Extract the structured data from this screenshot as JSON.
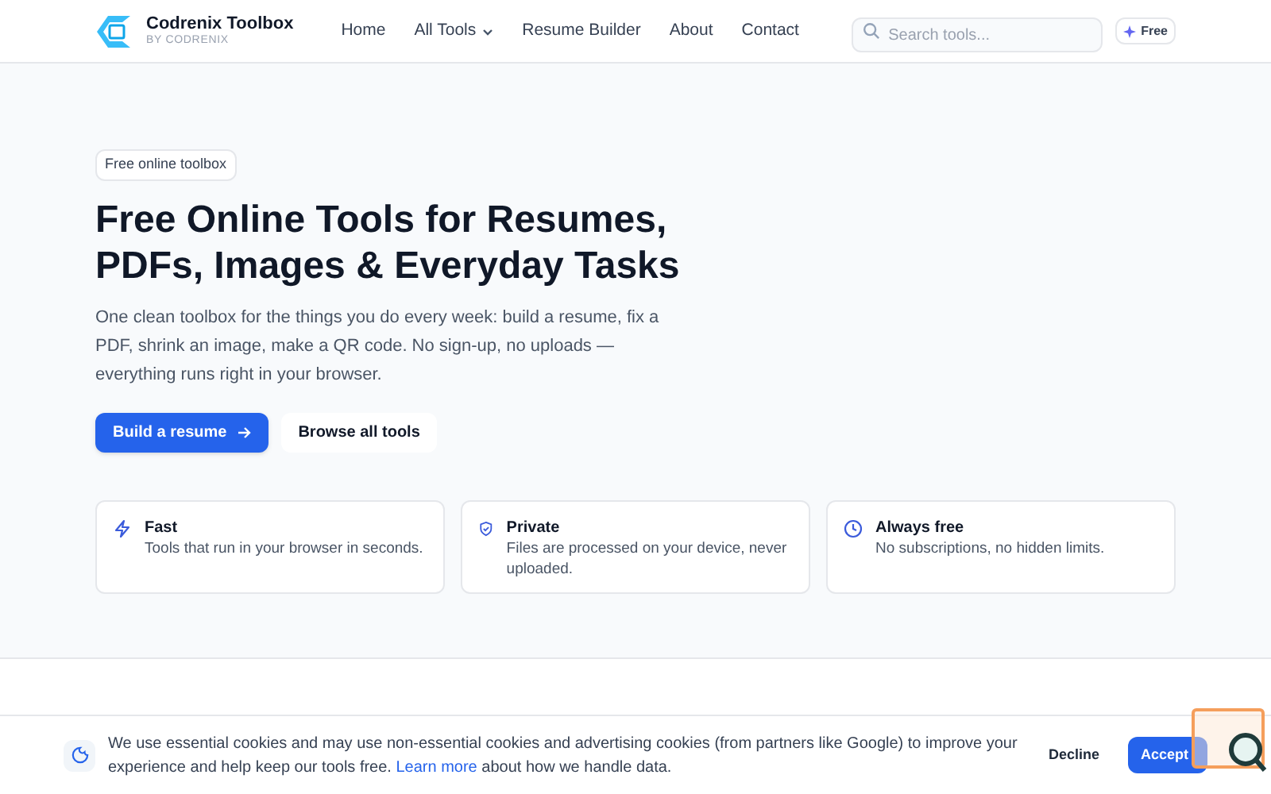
{
  "header": {
    "brand": "Codrenix Toolbox",
    "tagline": "BY CODRENIX",
    "nav": [
      {
        "label": "Home",
        "dropdown": false
      },
      {
        "label": "All Tools",
        "dropdown": true
      },
      {
        "label": "Resume Builder",
        "dropdown": false
      },
      {
        "label": "About",
        "dropdown": false
      },
      {
        "label": "Contact",
        "dropdown": false
      }
    ],
    "search": {
      "placeholder": "Search tools..."
    },
    "badge": "Free"
  },
  "hero": {
    "eyebrow": "Free online toolbox",
    "title": "Free Online Tools for Resumes, PDFs, Images & Everyday Tasks",
    "text": "One clean toolbox for the things you do every week: build a resume, fix a PDF, shrink an image, make a QR code. No sign-up, no uploads — everything runs right in your browser.",
    "buttons": [
      {
        "label": "Build a resume",
        "kind": "primary"
      },
      {
        "label": "Browse all tools",
        "kind": "secondary"
      }
    ]
  },
  "features": [
    {
      "kind": "bolt",
      "title": "Fast",
      "text": "Tools that run in your browser in seconds."
    },
    {
      "kind": "shield",
      "title": "Private",
      "text": "Files are processed on your device, never uploaded."
    },
    {
      "kind": "clock",
      "title": "Always free",
      "text": "No subscriptions, no hidden limits."
    }
  ],
  "cookie_banner": {
    "text_before": "We use essential cookies and may use non-essential cookies and advertising cookies (from partners like Google) to improve your experience and help keep our tools free.",
    "link": "Learn more",
    "text_after": "about how we handle data.",
    "buttons": [
      {
        "label": "Decline",
        "kind": "secondary"
      },
      {
        "label": "Accept",
        "kind": "primary"
      }
    ]
  }
}
